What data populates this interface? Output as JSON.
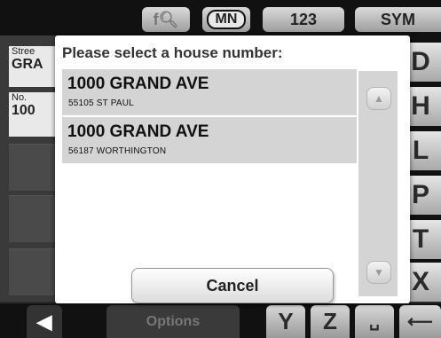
{
  "topbar": {
    "search_icon": "search-icon",
    "state_label": "MN",
    "numeric_label": "123",
    "symbol_label": "SYM"
  },
  "left_panel": {
    "street_label": "Stree",
    "street_value": "GRA",
    "number_label": "No.",
    "number_value": "100"
  },
  "right_keys": [
    "D",
    "H",
    "L",
    "P",
    "T",
    "X"
  ],
  "bottom_bar": {
    "back_icon": "back-arrow-icon",
    "options_label": "Options",
    "y_key": "Y",
    "z_key": "Z",
    "space_key": "␣",
    "backspace_icon": "backspace-icon"
  },
  "dialog": {
    "title": "Please select a house number:",
    "items": [
      {
        "main": "1000 GRAND AVE",
        "sub": "55105 ST PAUL"
      },
      {
        "main": "1000 GRAND AVE",
        "sub": "56187 WORTHINGTON"
      }
    ],
    "scroll_up_icon": "chevron-up-icon",
    "scroll_down_icon": "chevron-down-icon",
    "cancel_label": "Cancel"
  }
}
